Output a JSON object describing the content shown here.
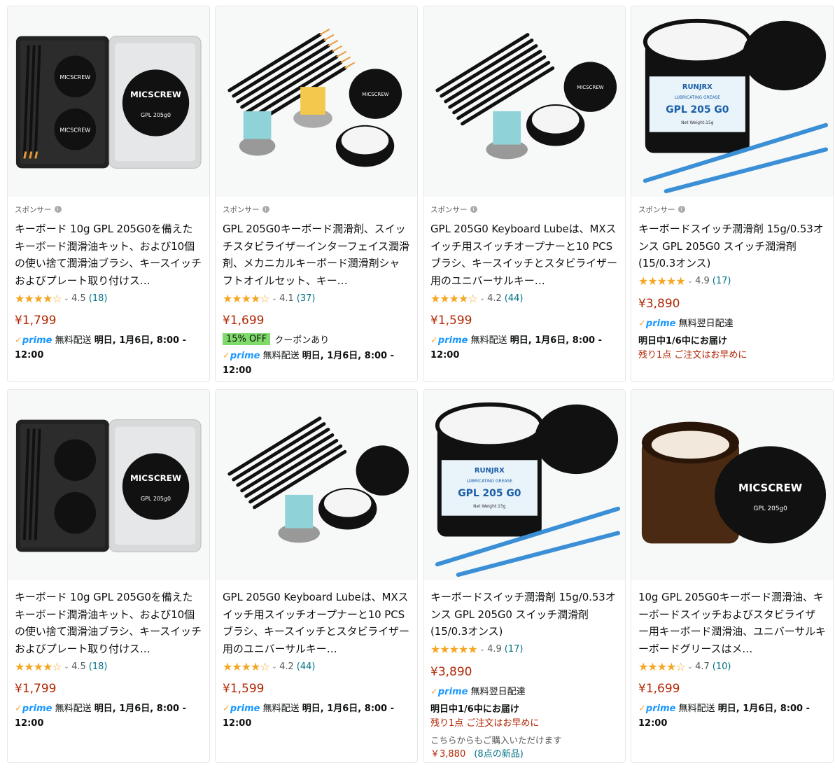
{
  "products": [
    {
      "sponsor": "スポンサー",
      "title": "キーボード 10g GPL 205G0を備えたキーボード潤滑油キット、および10個の使い捨て潤滑油ブラシ、キースイッチおよびプレート取り付けス…",
      "stars": "★★★★☆",
      "rating": "4.5",
      "count": "(18)",
      "price": "¥1,799",
      "prime": "prime",
      "ship_label": "無料配送",
      "ship_date": "明日, 1月6日, 8:00 - 12:00"
    },
    {
      "sponsor": "スポンサー",
      "title": "GPL 205G0キーボード潤滑剤、スイッチスタビライザーインターフェイス潤滑剤、メカニカルキーボード潤滑剤シャフトオイルセット、キー…",
      "stars": "★★★★☆",
      "rating": "4.1",
      "count": "(37)",
      "price": "¥1,699",
      "coupon_badge": "15% OFF",
      "coupon_text": "クーポンあり",
      "prime": "prime",
      "ship_label": "無料配送",
      "ship_date": "明日, 1月6日, 8:00 - 12:00"
    },
    {
      "sponsor": "スポンサー",
      "title": "GPL 205G0 Keyboard Lubeは、MXスイッチ用スイッチオープナーと10 PCSブラシ、キースイッチとスタビライザー用のユニバーサルキー…",
      "stars": "★★★★☆",
      "rating": "4.2",
      "count": "(44)",
      "price": "¥1,599",
      "prime": "prime",
      "ship_label": "無料配送",
      "ship_date": "明日, 1月6日, 8:00 - 12:00"
    },
    {
      "sponsor": "スポンサー",
      "title": "キーボードスイッチ潤滑剤 15g/0.53オンス GPL 205G0 スイッチ潤滑剤 (15/0.3オンス)",
      "stars": "★★★★★",
      "rating": "4.9",
      "count": "(17)",
      "price": "¥3,890",
      "prime": "prime",
      "ship_label": "無料翌日配達",
      "ship_date": "明日中1/6中にお届け",
      "stock": "残り1点 ご注文はお早めに"
    },
    {
      "title": "キーボード 10g GPL 205G0を備えたキーボード潤滑油キット、および10個の使い捨て潤滑油ブラシ、キースイッチおよびプレート取り付けス…",
      "stars": "★★★★☆",
      "rating": "4.5",
      "count": "(18)",
      "price": "¥1,799",
      "prime": "prime",
      "ship_label": "無料配送",
      "ship_date": "明日, 1月6日, 8:00 - 12:00"
    },
    {
      "title": "GPL 205G0 Keyboard Lubeは、MXスイッチ用スイッチオープナーと10 PCSブラシ、キースイッチとスタビライザー用のユニバーサルキー…",
      "stars": "★★★★☆",
      "rating": "4.2",
      "count": "(44)",
      "price": "¥1,599",
      "prime": "prime",
      "ship_label": "無料配送",
      "ship_date": "明日, 1月6日, 8:00 - 12:00"
    },
    {
      "title": "キーボードスイッチ潤滑剤 15g/0.53オンス GPL 205G0 スイッチ潤滑剤 (15/0.3オンス)",
      "stars": "★★★★★",
      "rating": "4.9",
      "count": "(17)",
      "price": "¥3,890",
      "prime": "prime",
      "ship_label": "無料翌日配達",
      "ship_date": "明日中1/6中にお届け",
      "stock": "残り1点 ご注文はお早めに",
      "other_text": "こちらからもご購入いただけます",
      "other_price": "￥3,880",
      "other_link": "(8点の新品)"
    },
    {
      "title": "10g GPL 205G0キーボード潤滑油、キーボードスイッチおよびスタビライザー用キーボード潤滑油、ユニバーサルキーボードグリースはメ…",
      "stars": "★★★★☆",
      "rating": "4.7",
      "count": "(10)",
      "price": "¥1,699",
      "prime": "prime",
      "ship_label": "無料配送",
      "ship_date": "明日, 1月6日, 8:00 - 12:00"
    }
  ],
  "image_texts": {
    "micscrew": "MICSCREW",
    "gpl": "GPL 205g0",
    "runjrx": "RUNJRX",
    "lubricating": "LUBRICATING GREASE",
    "gpl_big": "GPL 205 G0",
    "net_weight": "Net Weight:15g"
  },
  "colors": {
    "price": "#b12704",
    "link": "#007185",
    "star": "#f5a623",
    "prime": "#1a98ff",
    "coupon": "#7fda69"
  }
}
